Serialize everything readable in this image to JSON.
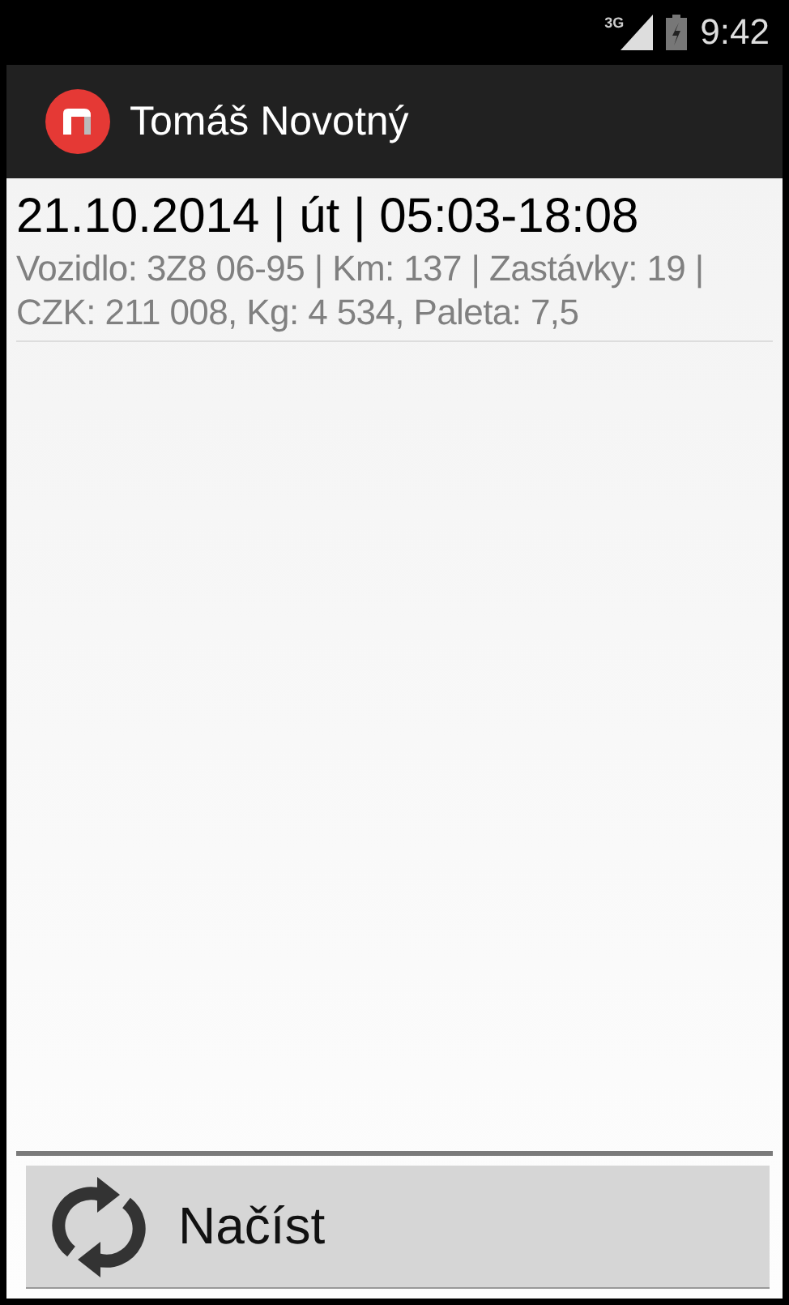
{
  "status_bar": {
    "network": "3G",
    "time": "9:42"
  },
  "action_bar": {
    "title": "Tomáš Novotný"
  },
  "trips": [
    {
      "title": "21.10.2014 | út | 05:03-18:08",
      "details": "Vozidlo: 3Z8 06-95 | Km: 137 | Zastávky: 19 | CZK: 211 008, Kg: 4 534, Paleta: 7,5"
    }
  ],
  "load_button": {
    "label": "Načíst"
  }
}
